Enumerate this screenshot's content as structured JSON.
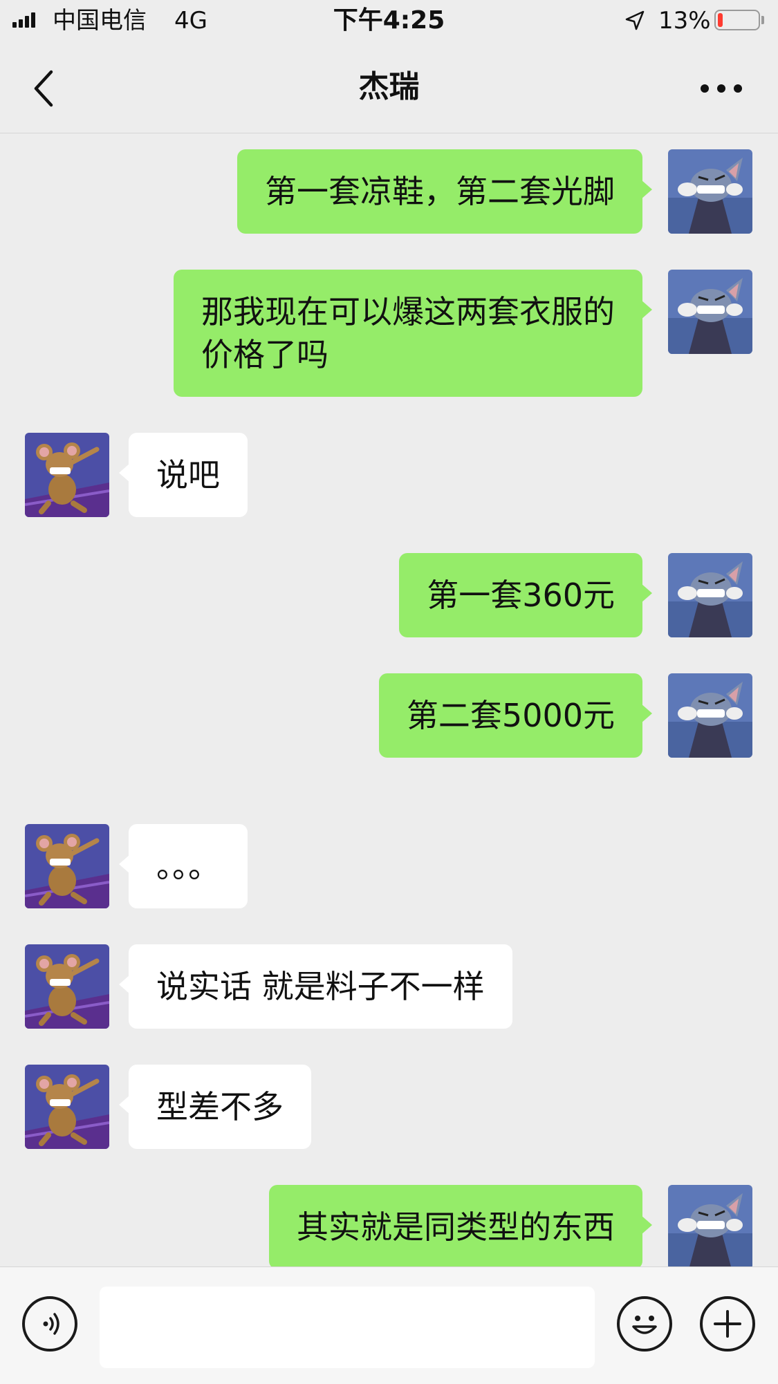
{
  "status_bar": {
    "carrier": "中国电信",
    "network": "4G",
    "time": "下午4:25",
    "battery_percent": "13%",
    "battery_level": 0.13,
    "signal_bars": 4,
    "icons": [
      "signal-icon",
      "location-arrow-icon",
      "battery-icon"
    ]
  },
  "nav": {
    "title": "杰瑞",
    "icons": [
      "back-chevron-icon",
      "more-dots-icon"
    ]
  },
  "messages": [
    {
      "side": "out",
      "text": "第一套凉鞋，第二套光脚"
    },
    {
      "side": "out",
      "text": "那我现在可以爆这两套衣服的\n价格了吗"
    },
    {
      "side": "in",
      "text": "说吧"
    },
    {
      "side": "out",
      "text": "第一套360元"
    },
    {
      "side": "out",
      "text": "第二套5000元"
    },
    {
      "side": "in",
      "text": "。。。"
    },
    {
      "side": "in",
      "text": "说实话 就是料子不一样"
    },
    {
      "side": "in",
      "text": "型差不多"
    },
    {
      "side": "out",
      "text": "其实就是同类型的东西"
    }
  ],
  "input_bar": {
    "placeholder": "",
    "icons": [
      "voice-icon",
      "emoji-icon",
      "plus-icon"
    ]
  },
  "colors": {
    "background": "#ededed",
    "outgoing_bubble": "#95ec69",
    "incoming_bubble": "#ffffff",
    "battery_low": "#ff3b30"
  }
}
